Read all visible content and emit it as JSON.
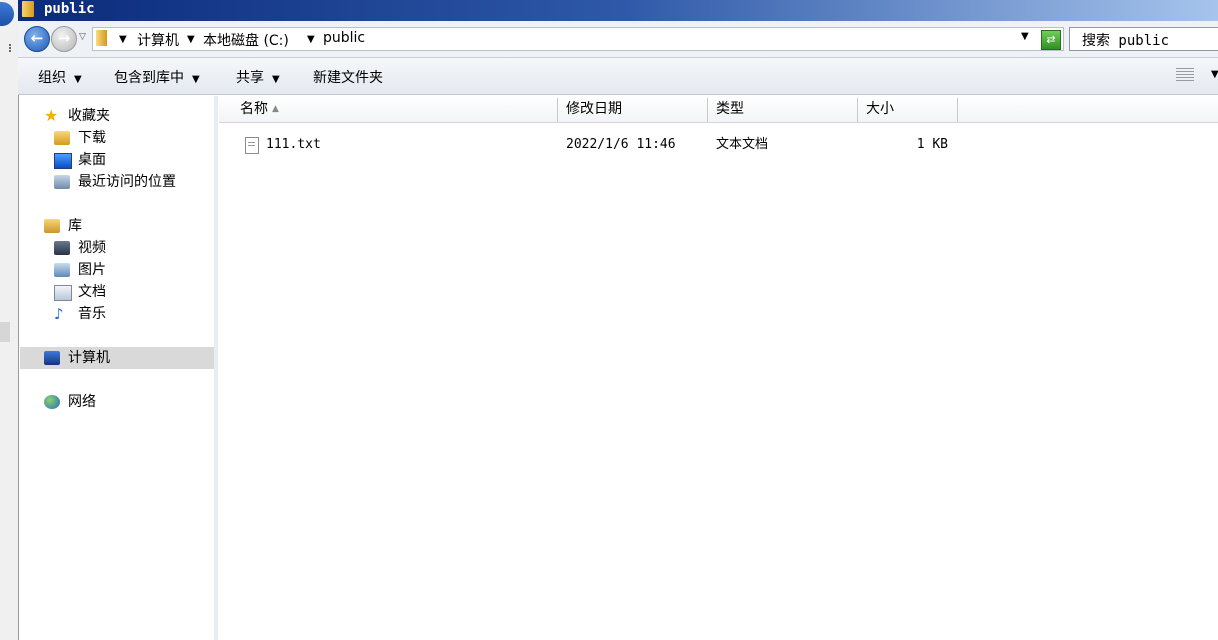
{
  "window": {
    "title": "public"
  },
  "address": {
    "crumbs": [
      "计算机",
      "本地磁盘 (C:)",
      "public"
    ],
    "search_placeholder": "搜索 public"
  },
  "toolbar": {
    "organize": "组织",
    "include_in_library": "包含到库中",
    "share": "共享",
    "new_folder": "新建文件夹"
  },
  "nav": {
    "favorites": "收藏夹",
    "downloads": "下载",
    "desktop": "桌面",
    "recent": "最近访问的位置",
    "libraries": "库",
    "videos": "视频",
    "pictures": "图片",
    "documents": "文档",
    "music": "音乐",
    "computer": "计算机",
    "network": "网络"
  },
  "columns": {
    "name": "名称",
    "modified": "修改日期",
    "type": "类型",
    "size": "大小"
  },
  "files": [
    {
      "name": "111.txt",
      "modified": "2022/1/6 11:46",
      "type": "文本文档",
      "size": "1 KB"
    }
  ]
}
